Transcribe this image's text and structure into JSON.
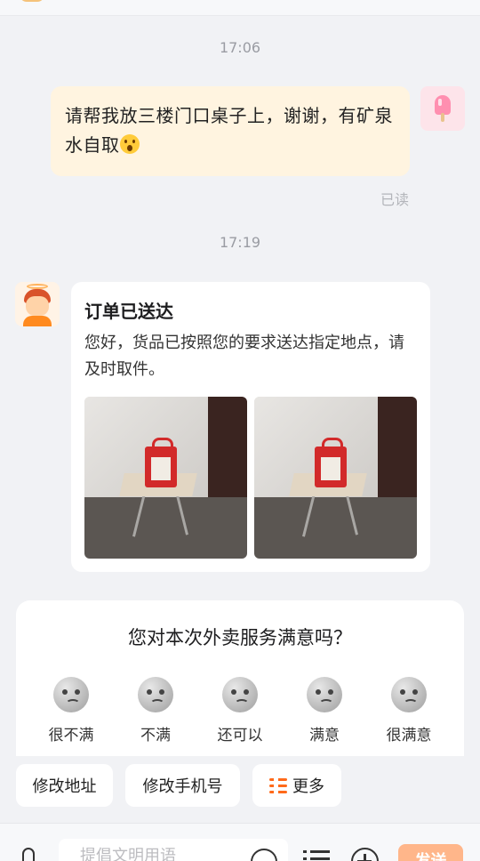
{
  "chat": {
    "time_1": "17:06",
    "user_message": "请帮我放三楼门口桌子上，谢谢，有矿泉水自取",
    "read_status": "已读",
    "time_2": "17:19"
  },
  "order_card": {
    "title": "订单已送达",
    "body": "您好，货品已按照您的要求送达指定地点，请及时取件。"
  },
  "survey": {
    "title": "您对本次外卖服务满意吗？",
    "options": [
      {
        "label": "很不满",
        "icon": "very-unsatisfied-face-icon"
      },
      {
        "label": "不满",
        "icon": "unsatisfied-face-icon"
      },
      {
        "label": "还可以",
        "icon": "neutral-face-icon"
      },
      {
        "label": "满意",
        "icon": "satisfied-face-icon"
      },
      {
        "label": "很满意",
        "icon": "very-satisfied-face-icon"
      }
    ]
  },
  "quick_actions": {
    "edit_address": "修改地址",
    "edit_phone": "修改手机号",
    "more": "更多"
  },
  "input_bar": {
    "placeholder": "提倡文明用语",
    "send": "发送"
  },
  "colors": {
    "accent": "#ff6a1a",
    "send_button": "#ffb68a",
    "outgoing_bubble": "#fff4e0"
  }
}
